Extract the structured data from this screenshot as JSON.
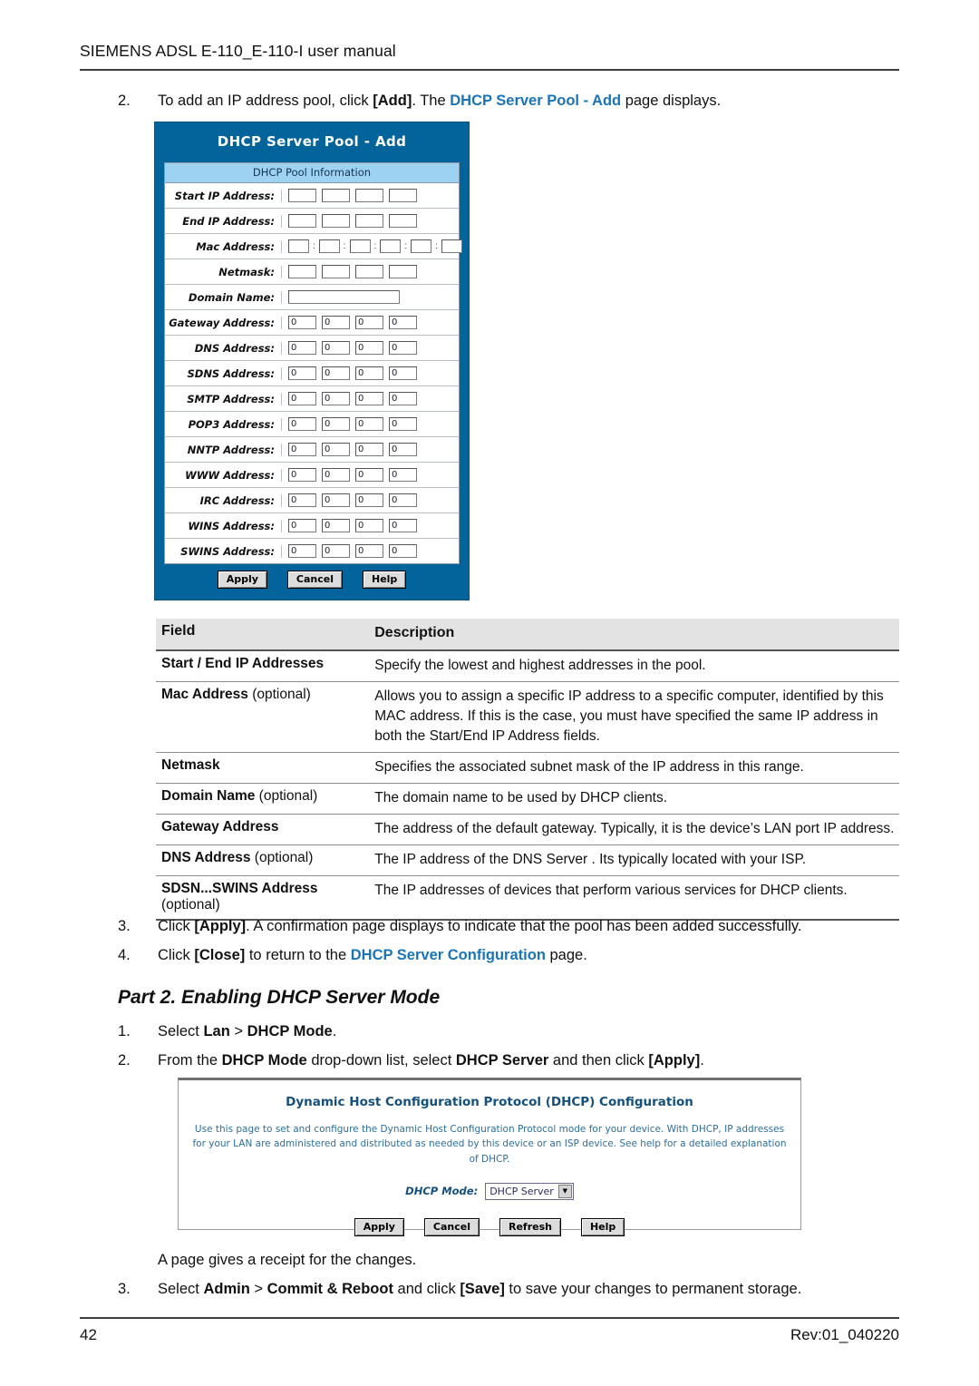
{
  "header": {
    "running_head": "SIEMENS ADSL E-110_E-110-I user manual"
  },
  "steps": {
    "s2_num": "2.",
    "s2_a": "To add an IP address pool, click ",
    "s2_b": "[Add]",
    "s2_c": ". The ",
    "s2_link": "DHCP Server Pool - Add",
    "s2_d": " page displays.",
    "s3_num": "3.",
    "s3_a": "Click ",
    "s3_b": "[Apply]",
    "s3_c": ". A confirmation page displays to indicate that the pool has been added successfully.",
    "s4_num": "4.",
    "s4_a": "Click ",
    "s4_b": "[Close]",
    "s4_c": " to return to the ",
    "s4_link": "DHCP Server Configuration",
    "s4_d": " page.",
    "p2_1_num": "1.",
    "p2_1_a": "Select ",
    "p2_1_b": "Lan",
    "p2_1_c": " > ",
    "p2_1_d": "DHCP Mode",
    "p2_1_e": ".",
    "p2_2_num": "2.",
    "p2_2_a": "From the ",
    "p2_2_b": "DHCP Mode",
    "p2_2_c": " drop-down list, select ",
    "p2_2_d": "DHCP Server",
    "p2_2_e": " and then click ",
    "p2_2_f": "[Apply]",
    "p2_2_g": ".",
    "receipt": "A page gives a receipt for the changes.",
    "s5_num": "3.",
    "s5_a": "Select ",
    "s5_b": "Admin",
    "s5_c": " > ",
    "s5_d": "Commit & Reboot",
    "s5_e": " and click ",
    "s5_f": "[Save]",
    "s5_g": " to save your changes to permanent storage."
  },
  "part_heading": "Part 2. Enabling DHCP Server Mode",
  "panel1": {
    "title": "DHCP Server Pool - Add",
    "section_bar": "DHCP Pool Information",
    "rows": [
      {
        "label": "Start IP Address:",
        "type": "octet4",
        "values": [
          "",
          "",
          "",
          ""
        ]
      },
      {
        "label": "End IP Address:",
        "type": "octet4",
        "values": [
          "",
          "",
          "",
          ""
        ]
      },
      {
        "label": "Mac Address:",
        "type": "mac6",
        "values": [
          "",
          "",
          "",
          "",
          "",
          ""
        ],
        "separator": ":"
      },
      {
        "label": "Netmask:",
        "type": "octet4",
        "values": [
          "",
          "",
          "",
          ""
        ]
      },
      {
        "label": "Domain Name:",
        "type": "text",
        "values": [
          ""
        ]
      },
      {
        "label": "Gateway Address:",
        "type": "octet4",
        "values": [
          "0",
          "0",
          "0",
          "0"
        ]
      },
      {
        "label": "DNS Address:",
        "type": "octet4",
        "values": [
          "0",
          "0",
          "0",
          "0"
        ]
      },
      {
        "label": "SDNS Address:",
        "type": "octet4",
        "values": [
          "0",
          "0",
          "0",
          "0"
        ]
      },
      {
        "label": "SMTP Address:",
        "type": "octet4",
        "values": [
          "0",
          "0",
          "0",
          "0"
        ]
      },
      {
        "label": "POP3 Address:",
        "type": "octet4",
        "values": [
          "0",
          "0",
          "0",
          "0"
        ]
      },
      {
        "label": "NNTP Address:",
        "type": "octet4",
        "values": [
          "0",
          "0",
          "0",
          "0"
        ]
      },
      {
        "label": "WWW Address:",
        "type": "octet4",
        "values": [
          "0",
          "0",
          "0",
          "0"
        ]
      },
      {
        "label": "IRC Address:",
        "type": "octet4",
        "values": [
          "0",
          "0",
          "0",
          "0"
        ]
      },
      {
        "label": "WINS Address:",
        "type": "octet4",
        "values": [
          "0",
          "0",
          "0",
          "0"
        ]
      },
      {
        "label": "SWINS Address:",
        "type": "octet4",
        "values": [
          "0",
          "0",
          "0",
          "0"
        ]
      }
    ],
    "buttons": [
      "Apply",
      "Cancel",
      "Help"
    ],
    "colors": {
      "panel_blue": "#02649a",
      "section_bar_blue": "#9ed2f2",
      "title_text": "#ffffff"
    }
  },
  "panel2": {
    "title": "Dynamic Host Configuration Protocol (DHCP) Configuration",
    "description": "Use this page to set and configure the Dynamic Host Configuration Protocol mode for your device. With DHCP, IP addresses for your LAN are administered and distributed as needed by this device or an ISP device. See help for a detailed explanation of DHCP.",
    "mode_label": "DHCP Mode:",
    "mode_value": "DHCP Server",
    "buttons": [
      "Apply",
      "Cancel",
      "Refresh",
      "Help"
    ],
    "colors": {
      "title_text": "#14507f",
      "desc_text": "#2d6f9e"
    }
  },
  "table": {
    "headers": [
      "Field",
      "Description"
    ],
    "rows": [
      {
        "field_bold": "Start / End IP Addresses",
        "field_opt": "",
        "desc": "Specify the lowest and highest addresses in the pool."
      },
      {
        "field_bold": "Mac Address",
        "field_opt": " (optional)",
        "desc": "Allows you to assign a specific IP address to a specific computer, identified by this MAC address. If this is the case, you must have specified the same IP address in both the Start/End IP Address fields."
      },
      {
        "field_bold": "Netmask",
        "field_opt": "",
        "desc": "Specifies the associated subnet mask of the IP address in this range."
      },
      {
        "field_bold": "Domain Name",
        "field_opt": " (optional)",
        "desc": "The domain name to be used by DHCP clients."
      },
      {
        "field_bold": "Gateway Address",
        "field_opt": "",
        "desc": "The address of the default gateway. Typically, it is the device’s LAN port IP address."
      },
      {
        "field_bold": "DNS Address",
        "field_opt": " (optional)",
        "desc": "The IP address of the DNS Server . Its typically located with your ISP."
      },
      {
        "field_bold": "SDSN...SWINS Address",
        "field_opt": "\n(optional)",
        "desc": "The IP addresses of devices that perform various services for DHCP clients."
      }
    ]
  },
  "footer": {
    "page_number": "42",
    "revision": "Rev:01_040220"
  }
}
